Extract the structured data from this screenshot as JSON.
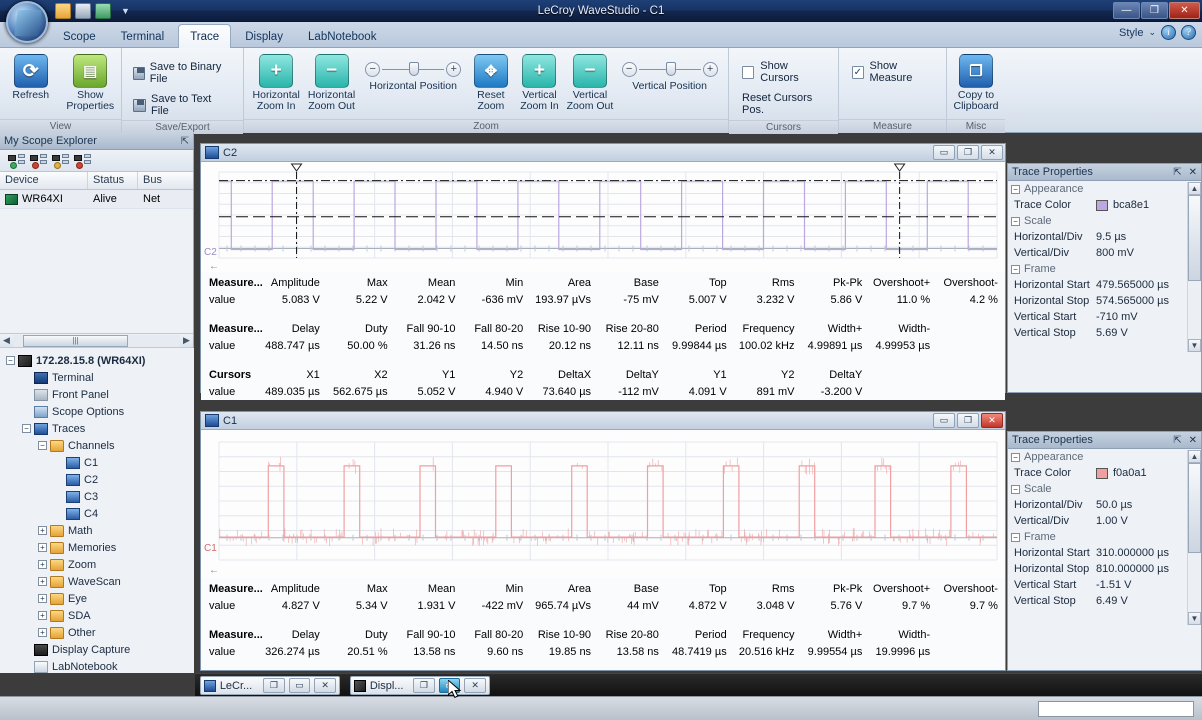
{
  "window": {
    "title": "LeCroy WaveStudio - C1",
    "minimize": "—",
    "restore": "❐",
    "close": "✕"
  },
  "quick_access": {
    "open_label": "open-file",
    "save_label": "save",
    "print_label": "print",
    "more": "▼"
  },
  "ribbon": {
    "tabs": [
      {
        "label": "Scope",
        "active": false
      },
      {
        "label": "Terminal",
        "active": false
      },
      {
        "label": "Trace",
        "active": true
      },
      {
        "label": "Display",
        "active": false
      },
      {
        "label": "LabNotebook",
        "active": false
      }
    ],
    "style_label": "Style",
    "style_caret": "⌄",
    "info_glyph": "i",
    "help_glyph": "?",
    "groups": [
      {
        "name": "View",
        "buttons": [
          {
            "label_line1": "Refresh",
            "label_line2": "",
            "icon": "refresh-icon"
          },
          {
            "label_line1": "Show",
            "label_line2": "Properties",
            "icon": "properties-icon"
          }
        ]
      },
      {
        "name": "Save/Export",
        "items": [
          {
            "label": "Save to Binary File",
            "icon": "disk-icon"
          },
          {
            "label": "Save to Text File",
            "icon": "disk-icon"
          }
        ]
      },
      {
        "name": "Zoom",
        "buttons": [
          {
            "label_line1": "Horizontal",
            "label_line2": "Zoom In",
            "icon": "zoom-in-icon"
          },
          {
            "label_line1": "Horizontal",
            "label_line2": "Zoom Out",
            "icon": "zoom-out-icon"
          },
          {
            "label_line1": "Reset",
            "label_line2": "Zoom",
            "icon": "reset-zoom-icon"
          },
          {
            "label_line1": "Vertical",
            "label_line2": "Zoom In",
            "icon": "zoom-in-icon"
          },
          {
            "label_line1": "Vertical",
            "label_line2": "Zoom Out",
            "icon": "zoom-out-icon"
          }
        ],
        "sliders": [
          {
            "label": "Horizontal Position",
            "minus": "−",
            "plus": "+"
          },
          {
            "label": "Vertical Position",
            "minus": "−",
            "plus": "+"
          }
        ]
      },
      {
        "name": "Cursors",
        "checkbox": {
          "label": "Show Cursors",
          "checked": false,
          "mark": ""
        },
        "link": "Reset Cursors Pos."
      },
      {
        "name": "Measure",
        "checkbox": {
          "label": "Show Measure",
          "checked": true,
          "mark": "✓"
        }
      },
      {
        "name": "Misc",
        "buttons": [
          {
            "label_line1": "Copy to",
            "label_line2": "Clipboard",
            "icon": "clipboard-icon"
          }
        ]
      }
    ]
  },
  "explorer": {
    "title": "My Scope Explorer",
    "pin": "⇱",
    "toolbar_icons": [
      "add-device-icon",
      "remove-device-icon",
      "refresh-device-icon",
      "delete-device-icon"
    ],
    "columns": [
      "Device",
      "Status",
      "Bus"
    ],
    "rows": [
      {
        "device": "WR64XI",
        "status": "Alive",
        "bus": "Net"
      }
    ],
    "scroll_grip": "|||"
  },
  "tree": {
    "nodes": [
      {
        "depth": 0,
        "expander": "−",
        "icon": "device-icon",
        "label": "172.28.15.8 (WR64XI)",
        "bold": true
      },
      {
        "depth": 1,
        "expander": "",
        "icon": "terminal-icon",
        "label": "Terminal",
        "bold": false
      },
      {
        "depth": 1,
        "expander": "",
        "icon": "frontpanel-icon",
        "label": "Front Panel",
        "bold": false
      },
      {
        "depth": 1,
        "expander": "",
        "icon": "options-icon",
        "label": "Scope Options",
        "bold": false
      },
      {
        "depth": 1,
        "expander": "−",
        "icon": "traces-icon",
        "label": "Traces",
        "bold": false
      },
      {
        "depth": 2,
        "expander": "−",
        "icon": "folder-icon",
        "label": "Channels",
        "bold": false
      },
      {
        "depth": 3,
        "expander": "",
        "icon": "channel-icon",
        "label": "C1",
        "bold": false
      },
      {
        "depth": 3,
        "expander": "",
        "icon": "channel-icon",
        "label": "C2",
        "bold": false
      },
      {
        "depth": 3,
        "expander": "",
        "icon": "channel-icon",
        "label": "C3",
        "bold": false
      },
      {
        "depth": 3,
        "expander": "",
        "icon": "channel-icon",
        "label": "C4",
        "bold": false
      },
      {
        "depth": 2,
        "expander": "+",
        "icon": "folder-icon",
        "label": "Math",
        "bold": false
      },
      {
        "depth": 2,
        "expander": "+",
        "icon": "folder-icon",
        "label": "Memories",
        "bold": false
      },
      {
        "depth": 2,
        "expander": "+",
        "icon": "folder-icon",
        "label": "Zoom",
        "bold": false
      },
      {
        "depth": 2,
        "expander": "+",
        "icon": "folder-icon",
        "label": "WaveScan",
        "bold": false
      },
      {
        "depth": 2,
        "expander": "+",
        "icon": "folder-icon",
        "label": "Eye",
        "bold": false
      },
      {
        "depth": 2,
        "expander": "+",
        "icon": "folder-icon",
        "label": "SDA",
        "bold": false
      },
      {
        "depth": 2,
        "expander": "+",
        "icon": "folder-icon",
        "label": "Other",
        "bold": false
      },
      {
        "depth": 1,
        "expander": "",
        "icon": "display-capture-icon",
        "label": "Display Capture",
        "bold": false
      },
      {
        "depth": 1,
        "expander": "",
        "icon": "labnotebook-icon",
        "label": "LabNotebook",
        "bold": false
      }
    ]
  },
  "trace_c2": {
    "title": "C2",
    "channel_label": "C2",
    "min_btn": "▭",
    "restore_btn": "❐",
    "close_btn": "✕",
    "close_hot": false,
    "color": "#bca8e1",
    "measure_rows": [
      {
        "lead": "Measure...",
        "lead_value": "value",
        "headers": [
          "Amplitude",
          "Max",
          "Mean",
          "Min",
          "Area",
          "Base",
          "Top",
          "Rms",
          "Pk-Pk",
          "Overshoot+",
          "Overshoot-"
        ],
        "values": [
          "5.083 V",
          "5.22 V",
          "2.042 V",
          "-636 mV",
          "193.97 µVs",
          "-75 mV",
          "5.007 V",
          "3.232 V",
          "5.86 V",
          "11.0 %",
          "4.2 %"
        ]
      },
      {
        "lead": "Measure...",
        "lead_value": "value",
        "headers": [
          "Delay",
          "Duty",
          "Fall 90-10",
          "Fall 80-20",
          "Rise 10-90",
          "Rise 20-80",
          "Period",
          "Frequency",
          "Width+",
          "Width-",
          ""
        ],
        "values": [
          "488.747 µs",
          "50.00 %",
          "31.26 ns",
          "14.50 ns",
          "20.12 ns",
          "12.11 ns",
          "9.99844 µs",
          "100.02 kHz",
          "4.99891 µs",
          "4.99953 µs",
          ""
        ]
      },
      {
        "lead": "Cursors",
        "lead_value": "value",
        "headers": [
          "X1",
          "X2",
          "Y1",
          "Y2",
          "DeltaX",
          "DeltaY",
          "Y1",
          "Y2",
          "DeltaY",
          "",
          ""
        ],
        "values": [
          "489.035 µs",
          "562.675 µs",
          "5.052 V",
          "4.940 V",
          "73.640 µs",
          "-112 mV",
          "4.091 V",
          "891 mV",
          "-3.200 V",
          "",
          ""
        ]
      }
    ]
  },
  "trace_c1": {
    "title": "C1",
    "channel_label": "C1",
    "min_btn": "▭",
    "restore_btn": "❐",
    "close_btn": "✕",
    "close_hot": true,
    "color": "#f0a0a1",
    "measure_rows": [
      {
        "lead": "Measure...",
        "lead_value": "value",
        "headers": [
          "Amplitude",
          "Max",
          "Mean",
          "Min",
          "Area",
          "Base",
          "Top",
          "Rms",
          "Pk-Pk",
          "Overshoot+",
          "Overshoot-"
        ],
        "values": [
          "4.827 V",
          "5.34 V",
          "1.931 V",
          "-422 mV",
          "965.74 µVs",
          "44 mV",
          "4.872 V",
          "3.048 V",
          "5.76 V",
          "9.7 %",
          "9.7 %"
        ]
      },
      {
        "lead": "Measure...",
        "lead_value": "value",
        "headers": [
          "Delay",
          "Duty",
          "Fall 90-10",
          "Fall 80-20",
          "Rise 10-90",
          "Rise 20-80",
          "Period",
          "Frequency",
          "Width+",
          "Width-",
          ""
        ],
        "values": [
          "326.274 µs",
          "20.51 %",
          "13.58 ns",
          "9.60 ns",
          "19.85 ns",
          "13.58 ns",
          "48.7419 µs",
          "20.516 kHz",
          "9.99554 µs",
          "19.9996 µs",
          ""
        ]
      }
    ]
  },
  "props_c2": {
    "title": "Trace Properties",
    "pin": "⇱",
    "close": "✕",
    "groups": [
      {
        "name": "Appearance",
        "expander": "−",
        "rows": [
          {
            "key": "Trace Color",
            "value": "bca8e1",
            "swatch": "#bca8e1"
          }
        ]
      },
      {
        "name": "Scale",
        "expander": "−",
        "rows": [
          {
            "key": "Horizontal/Div",
            "value": "9.5 µs"
          },
          {
            "key": "Vertical/Div",
            "value": "800 mV"
          }
        ]
      },
      {
        "name": "Frame",
        "expander": "−",
        "rows": [
          {
            "key": "Horizontal Start",
            "value": "479.565000 µs"
          },
          {
            "key": "Horizontal Stop",
            "value": "574.565000 µs"
          },
          {
            "key": "Vertical Start",
            "value": "-710 mV"
          },
          {
            "key": "Vertical Stop",
            "value": "5.69 V"
          }
        ]
      }
    ]
  },
  "props_c1": {
    "title": "Trace Properties",
    "pin": "⇱",
    "close": "✕",
    "groups": [
      {
        "name": "Appearance",
        "expander": "−",
        "rows": [
          {
            "key": "Trace Color",
            "value": "f0a0a1",
            "swatch": "#f0a0a1"
          }
        ]
      },
      {
        "name": "Scale",
        "expander": "−",
        "rows": [
          {
            "key": "Horizontal/Div",
            "value": "50.0 µs"
          },
          {
            "key": "Vertical/Div",
            "value": "1.00 V"
          }
        ]
      },
      {
        "name": "Frame",
        "expander": "−",
        "rows": [
          {
            "key": "Horizontal Start",
            "value": "310.000000 µs"
          },
          {
            "key": "Horizontal Stop",
            "value": "810.000000 µs"
          },
          {
            "key": "Vertical Start",
            "value": "-1.51 V"
          },
          {
            "key": "Vertical Stop",
            "value": "6.49 V"
          }
        ]
      }
    ]
  },
  "mdi_bar": {
    "items": [
      {
        "label": "LeCr...",
        "icon": "window-icon",
        "restore": "❐",
        "min": "▭",
        "close": "✕",
        "selected_btn": ""
      },
      {
        "label": "Displ...",
        "icon": "capture-icon",
        "restore": "❐",
        "min": "▭",
        "close": "✕",
        "selected_btn": "min"
      }
    ]
  },
  "chart_data": [
    {
      "type": "line",
      "title": "C2",
      "xlabel": "",
      "ylabel": "",
      "xlim": [
        479.565,
        574.565
      ],
      "ylim": [
        -0.71,
        5.69
      ],
      "x_unit": "µs",
      "y_unit": "V",
      "series": [
        {
          "name": "C2",
          "color": "#bca8e1",
          "waveform": "square",
          "period_us": 9.99844,
          "duty_pct": 50.0,
          "high_v": 5.007,
          "low_v": -0.075
        }
      ],
      "cursors": {
        "x1_us": 489.035,
        "x2_us": 562.675,
        "y1_v": 5.052,
        "y2_v": 4.94
      },
      "grid": true,
      "legend": false
    },
    {
      "type": "line",
      "title": "C1",
      "xlabel": "",
      "ylabel": "",
      "xlim": [
        310.0,
        810.0
      ],
      "ylim": [
        -1.51,
        6.49
      ],
      "x_unit": "µs",
      "y_unit": "V",
      "series": [
        {
          "name": "C1",
          "color": "#f0a0a1",
          "waveform": "square",
          "period_us": 48.7419,
          "duty_pct": 20.51,
          "high_v": 4.872,
          "low_v": 0.044
        }
      ],
      "grid": true,
      "legend": false
    }
  ]
}
